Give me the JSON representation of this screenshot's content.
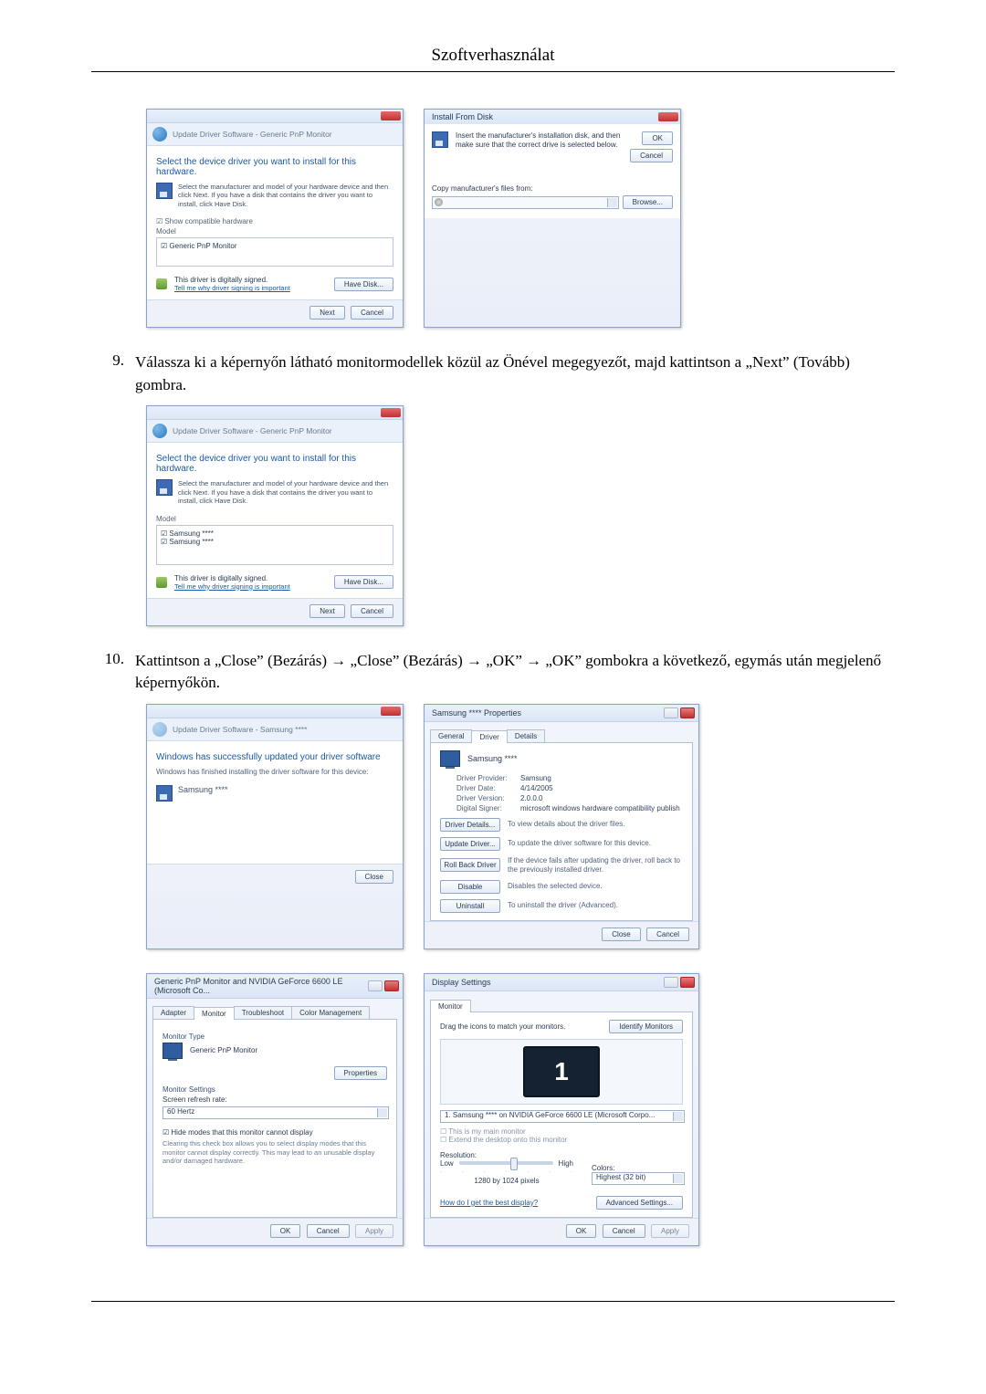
{
  "page_title": "Szoftverhasználat",
  "step9": {
    "num": "9.",
    "text": "Válassza ki a képernyőn látható monitormodellek közül az Önével megegyezőt, majd kattintson a „Next” (Tovább) gombra."
  },
  "step10": {
    "num": "10.",
    "text": "Kattintson a „Close” (Bezárás) → „Close” (Bezárás) → „OK” → „OK” gombokra a következő, egymás után megjelenő képernyőkön."
  },
  "dlg_update1": {
    "header": "Update Driver Software - Generic PnP Monitor",
    "heading": "Select the device driver you want to install for this hardware.",
    "sub": "Select the manufacturer and model of your hardware device and then click Next. If you have a disk that contains the driver you want to install, click Have Disk.",
    "show_compat": "Show compatible hardware",
    "model_label": "Model",
    "model_item": "Generic PnP Monitor",
    "signed_main": "This driver is digitally signed.",
    "signed_link": "Tell me why driver signing is important",
    "have_disk": "Have Disk...",
    "next": "Next",
    "cancel": "Cancel"
  },
  "dlg_ifd": {
    "title": "Install From Disk",
    "text": "Insert the manufacturer's installation disk, and then make sure that the correct drive is selected below.",
    "ok": "OK",
    "cancel": "Cancel",
    "copy_label": "Copy manufacturer's files from:",
    "browse": "Browse..."
  },
  "dlg_update2": {
    "header": "Update Driver Software - Generic PnP Monitor",
    "heading": "Select the device driver you want to install for this hardware.",
    "sub": "Select the manufacturer and model of your hardware device and then click Next. If you have a disk that contains the driver you want to install, click Have Disk.",
    "model_label": "Model",
    "model_item1": "Samsung ****",
    "model_item2": "Samsung ****",
    "signed_main": "This driver is digitally signed.",
    "signed_link": "Tell me why driver signing is important",
    "have_disk": "Have Disk...",
    "next": "Next",
    "cancel": "Cancel"
  },
  "dlg_finished": {
    "header": "Update Driver Software - Samsung ****",
    "heading": "Windows has successfully updated your driver software",
    "sub": "Windows has finished installing the driver software for this device:",
    "device": "Samsung ****",
    "close": "Close"
  },
  "dlg_props": {
    "title": "Samsung **** Properties",
    "tab_general": "General",
    "tab_driver": "Driver",
    "tab_details": "Details",
    "device": "Samsung ****",
    "kv": {
      "provider_k": "Driver Provider:",
      "provider_v": "Samsung",
      "date_k": "Driver Date:",
      "date_v": "4/14/2005",
      "version_k": "Driver Version:",
      "version_v": "2.0.0.0",
      "signer_k": "Digital Signer:",
      "signer_v": "microsoft windows hardware compatibility publish"
    },
    "btn_details": "Driver Details...",
    "desc_details": "To view details about the driver files.",
    "btn_update": "Update Driver...",
    "desc_update": "To update the driver software for this device.",
    "btn_rollback": "Roll Back Driver",
    "desc_rollback": "If the device fails after updating the driver, roll back to the previously installed driver.",
    "btn_disable": "Disable",
    "desc_disable": "Disables the selected device.",
    "btn_uninstall": "Uninstall",
    "desc_uninstall": "To uninstall the driver (Advanced).",
    "close": "Close",
    "cancel": "Cancel"
  },
  "dlg_pnp": {
    "title": "Generic PnP Monitor and NVIDIA GeForce 6600 LE (Microsoft Co...",
    "tab_adapter": "Adapter",
    "tab_monitor": "Monitor",
    "tab_troubleshoot": "Troubleshoot",
    "tab_color": "Color Management",
    "mon_type_lbl": "Monitor Type",
    "mon_type_val": "Generic PnP Monitor",
    "properties": "Properties",
    "mon_settings_lbl": "Monitor Settings",
    "refresh_lbl": "Screen refresh rate:",
    "refresh_val": "60 Hertz",
    "hide_chk": "Hide modes that this monitor cannot display",
    "hide_desc": "Clearing this check box allows you to select display modes that this monitor cannot display correctly. This may lead to an unusable display and/or damaged hardware.",
    "ok": "OK",
    "cancel": "Cancel",
    "apply": "Apply"
  },
  "dlg_ds": {
    "title": "Display Settings",
    "tab_monitor": "Monitor",
    "drag_lbl": "Drag the icons to match your monitors.",
    "identify": "Identify Monitors",
    "big1": "1",
    "select_val": "1. Samsung **** on NVIDIA GeForce 6600 LE (Microsoft Corpo...",
    "chk_main": "This is my main monitor",
    "chk_extend": "Extend the desktop onto this monitor",
    "res_lbl": "Resolution:",
    "low": "Low",
    "high": "High",
    "res_val": "1280 by 1024 pixels",
    "color_lbl": "Colors:",
    "color_val": "Highest (32 bit)",
    "help_link": "How do I get the best display?",
    "adv": "Advanced Settings...",
    "ok": "OK",
    "cancel": "Cancel",
    "apply": "Apply"
  }
}
